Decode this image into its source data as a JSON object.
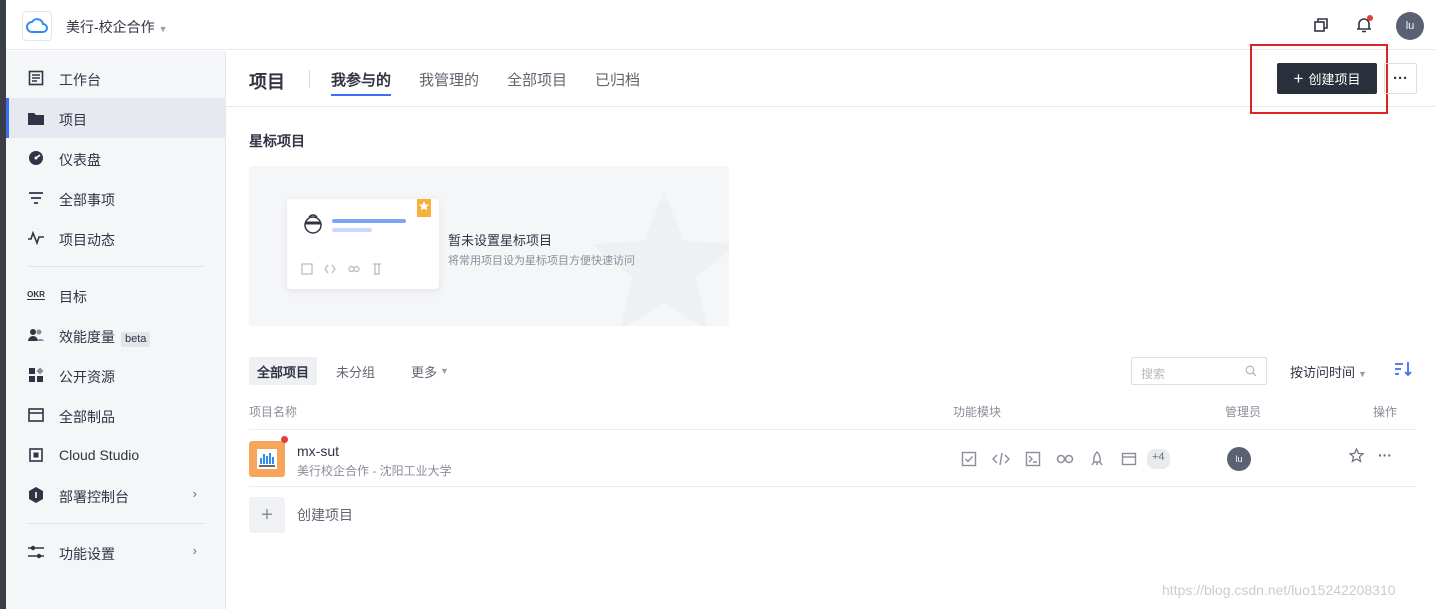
{
  "topbar": {
    "team_name": "美行-校企合作",
    "avatar_text": "lu"
  },
  "sidebar": {
    "items": [
      {
        "label": "工作台",
        "icon": "dashboard-icon"
      },
      {
        "label": "项目",
        "icon": "folder-icon",
        "active": true
      },
      {
        "label": "仪表盘",
        "icon": "gauge-icon"
      },
      {
        "label": "全部事项",
        "icon": "filter-icon"
      },
      {
        "label": "项目动态",
        "icon": "activity-icon"
      },
      {
        "label": "目标",
        "icon": "okr-icon",
        "icon_text": "OKR"
      },
      {
        "label": "效能度量",
        "icon": "users-icon",
        "badge": "beta"
      },
      {
        "label": "公开资源",
        "icon": "apps-icon"
      },
      {
        "label": "全部制品",
        "icon": "package-icon"
      },
      {
        "label": "Cloud Studio",
        "icon": "cloud-studio-icon"
      },
      {
        "label": "部署控制台",
        "icon": "deploy-icon",
        "has_submenu": true
      },
      {
        "label": "功能设置",
        "icon": "settings-icon",
        "has_submenu": true
      }
    ]
  },
  "header": {
    "title": "项目",
    "tabs": [
      {
        "label": "我参与的",
        "active": true
      },
      {
        "label": "我管理的"
      },
      {
        "label": "全部项目"
      },
      {
        "label": "已归档"
      }
    ],
    "create_button": "创建项目",
    "more_button": "···"
  },
  "starred": {
    "title": "星标项目",
    "empty_title": "暂未设置星标项目",
    "empty_subtitle": "将常用项目设为星标项目方便快速访问"
  },
  "filter": {
    "tabs": [
      {
        "label": "全部项目",
        "active": true
      },
      {
        "label": "未分组"
      },
      {
        "label": "更多"
      }
    ],
    "search_placeholder": "搜索",
    "sort_label": "按访问时间"
  },
  "table": {
    "columns": [
      "项目名称",
      "功能模块",
      "管理员",
      "操作"
    ],
    "rows": [
      {
        "name": "mx-sut",
        "description": "美行校企合作 - 沈阳工业大学",
        "modules": [
          "checklist-icon",
          "code-icon",
          "terminal-icon",
          "infinity-icon",
          "rocket-icon",
          "archive-icon"
        ],
        "more_modules": "+4",
        "manager": "lu"
      }
    ],
    "create_label": "创建项目"
  },
  "watermark": "https://blog.csdn.net/luo15242208310",
  "colors": {
    "accent": "#3b6ff5",
    "primary_button": "#2a2f3c",
    "highlight_box": "#e02222",
    "project_icon": "#f6a55b"
  }
}
